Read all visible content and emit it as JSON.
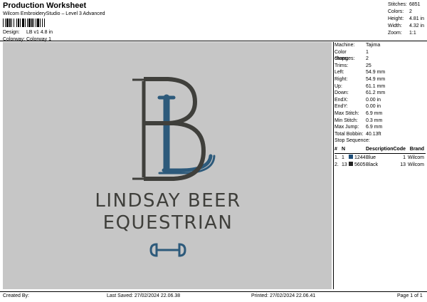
{
  "header": {
    "title": "Production Worksheet",
    "software": "Wilcom EmbroideryStudio – Level 3 Advanced",
    "design_label": "Design:",
    "design_value": "LB v1 4.8 in",
    "colorway_label": "Colorway:",
    "colorway_value": "Colorway 1"
  },
  "summary": [
    {
      "label": "Stitches:",
      "value": "6851"
    },
    {
      "label": "Colors:",
      "value": "2"
    },
    {
      "label": "Height:",
      "value": "4.81 in"
    },
    {
      "label": "Width:",
      "value": "4.32 in"
    },
    {
      "label": "Zoom:",
      "value": "1:1"
    }
  ],
  "design": {
    "line1": "LINDSAY BEER",
    "line2": "EQUESTRIAN",
    "colors": {
      "background": "#c6c6c6",
      "dark": "#3f3f3b",
      "blue": "#2d5a7b"
    }
  },
  "machine": [
    {
      "label": "Machine:",
      "value": "Tajima"
    },
    {
      "label": "Color changes:",
      "value": "1"
    },
    {
      "label": "Stops:",
      "value": "2"
    },
    {
      "label": "Trims:",
      "value": "25"
    },
    {
      "label": "Left:",
      "value": "54.9 mm"
    },
    {
      "label": "Right:",
      "value": "54.9 mm"
    },
    {
      "label": "Up:",
      "value": "61.1 mm"
    },
    {
      "label": "Down:",
      "value": "61.2 mm"
    },
    {
      "label": "EndX:",
      "value": "0.00 in"
    },
    {
      "label": "EndY:",
      "value": "0.00 in"
    },
    {
      "label": "Max Stitch:",
      "value": "6.9 mm"
    },
    {
      "label": "Min Stitch:",
      "value": "0.3 mm"
    },
    {
      "label": "Max Jump:",
      "value": "6.9 mm"
    },
    {
      "label": "Total Bobbin:",
      "value": "40.13ft"
    }
  ],
  "stop_sequence": {
    "title": "Stop Sequence:",
    "headers": {
      "hash": "#",
      "n": "N",
      "desc": "Description",
      "code": "Code",
      "brand": "Brand"
    },
    "rows": [
      {
        "index": "1.",
        "n": "1",
        "code": "1244",
        "desc": "Blue",
        "code2": "1",
        "brand": "Wilcom",
        "color": "#1e4e79"
      },
      {
        "index": "2.",
        "n": "13",
        "code": "5605",
        "desc": "Black",
        "code2": "13",
        "brand": "Wilcom",
        "color": "#222222"
      }
    ]
  },
  "footer": {
    "created": "Created By:",
    "saved": "Last Saved: 27/02/2024 22.06.38",
    "printed": "Printed: 27/02/2024 22.06.41",
    "page": "Page 1 of 1"
  }
}
